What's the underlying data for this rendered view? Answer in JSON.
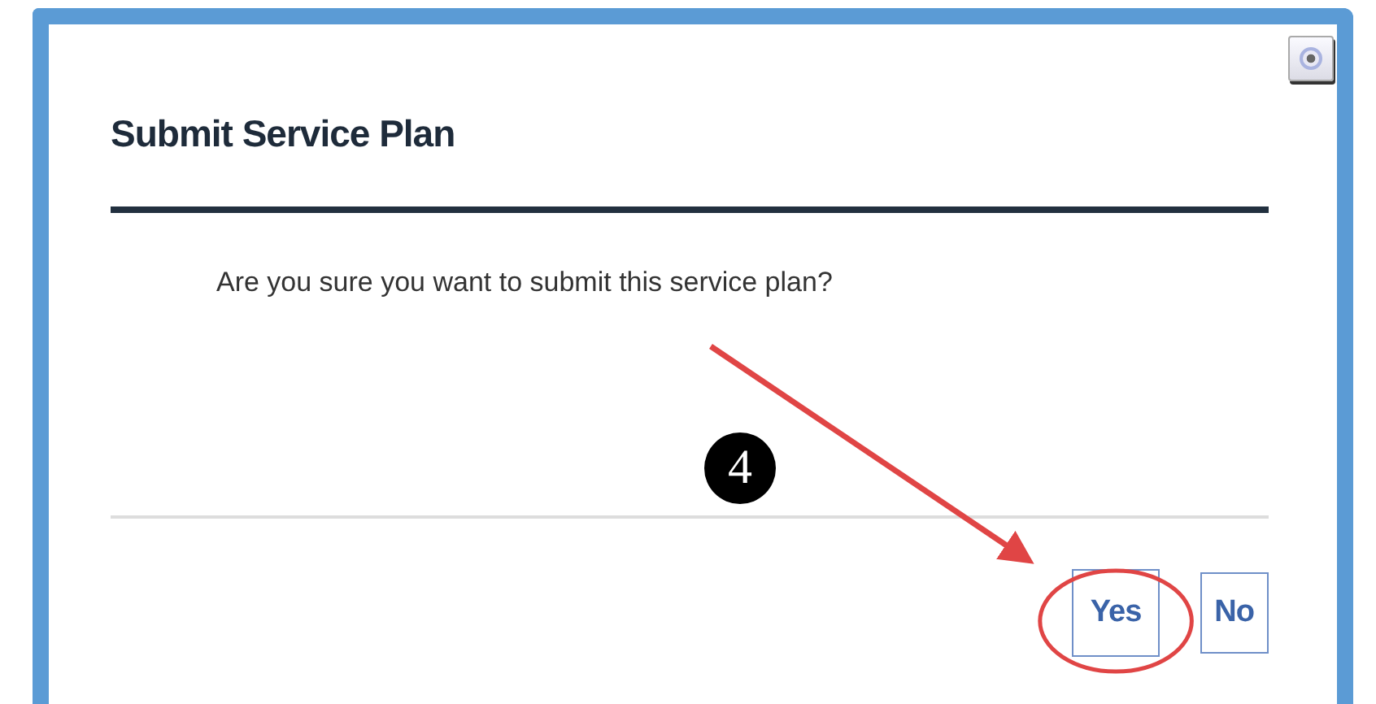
{
  "dialog": {
    "title": "Submit Service Plan",
    "message": "Are you sure you want to submit this service plan?",
    "buttons": [
      {
        "label": "Yes",
        "circled": true
      },
      {
        "label": "No",
        "circled": false
      }
    ]
  },
  "annotation": {
    "step": "4"
  }
}
